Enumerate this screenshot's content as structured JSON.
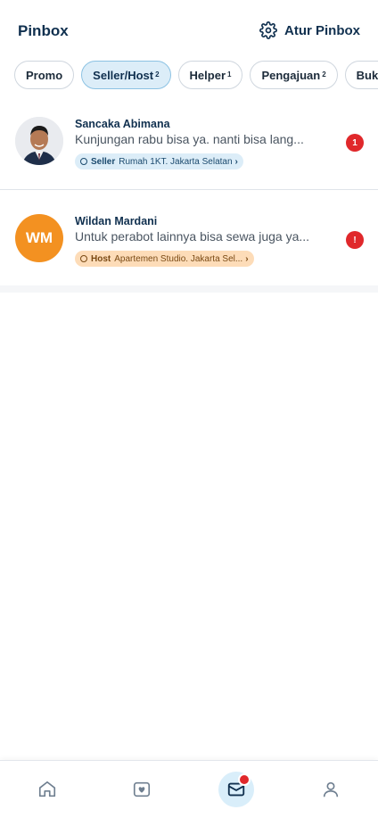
{
  "header": {
    "title": "Pinbox",
    "settings_label": "Atur Pinbox"
  },
  "tabs": [
    {
      "label": "Promo",
      "count": ""
    },
    {
      "label": "Seller/Host",
      "count": "2",
      "active": true
    },
    {
      "label": "Helper",
      "count": "1"
    },
    {
      "label": "Pengajuan",
      "count": "2"
    },
    {
      "label": "Bukti Tr",
      "count": ""
    }
  ],
  "conversations": [
    {
      "name": "Sancaka Abimana",
      "message": "Kunjungan rabu bisa ya. nanti bisa lang...",
      "chip_role": "Seller",
      "chip_text": "Rumah 1KT. Jakarta Selatan",
      "badge": "1"
    },
    {
      "name": "Wildan Mardani",
      "initials": "WM",
      "message": "Untuk perabot lainnya bisa sewa juga ya...",
      "chip_role": "Host",
      "chip_text": "Apartemen Studio. Jakarta Sel...",
      "badge": "!"
    }
  ],
  "colors": {
    "badge": "#e0282b",
    "accent": "#10304f",
    "seller_chip": "#dcedf8",
    "host_chip": "#fddcb8",
    "avatar_initials": "#f39121"
  },
  "bottom_nav": [
    "home-icon",
    "favorite-icon",
    "inbox-icon",
    "profile-icon"
  ]
}
